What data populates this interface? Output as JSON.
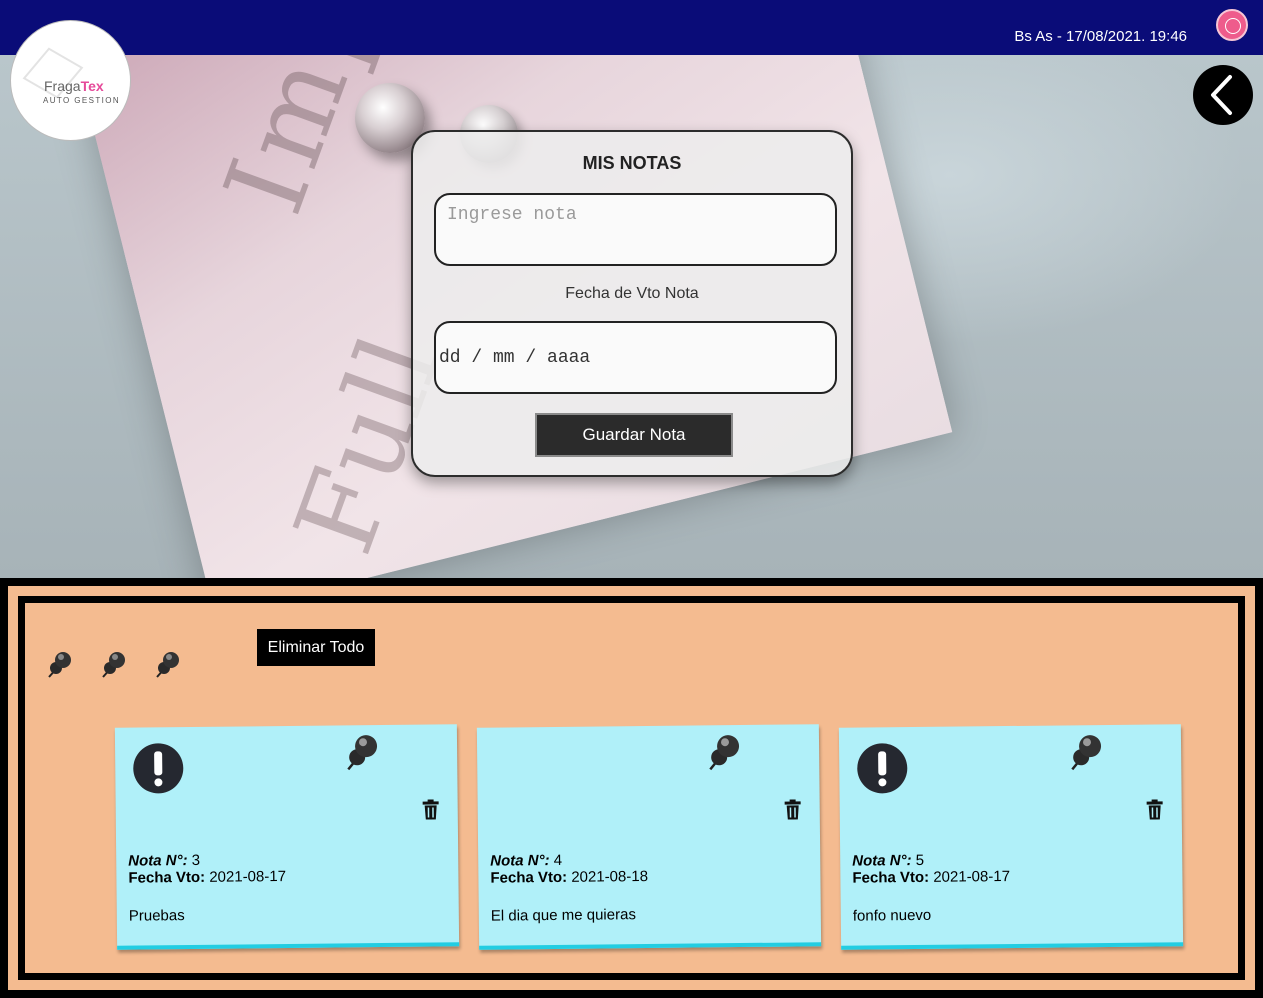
{
  "header": {
    "datetime": "Bs As - 17/08/2021. 19:46"
  },
  "logo": {
    "brand_a": "Fraga",
    "brand_b": "Tex",
    "subtitle": "AUTO GESTION"
  },
  "form": {
    "title": "MIS NOTAS",
    "note_placeholder": "Ingrese nota",
    "date_label": "Fecha de Vto Nota",
    "date_placeholder": "dd / mm / aaaa",
    "save_label": "Guardar Nota"
  },
  "board": {
    "delete_all_label": "Eliminar Todo",
    "number_label": "Nota N°:",
    "due_label": "Fecha Vto:",
    "notes": [
      {
        "number": "3",
        "due": "2021-08-17",
        "text": "Pruebas",
        "alert": true
      },
      {
        "number": "4",
        "due": "2021-08-18",
        "text": "El dia que me quieras",
        "alert": false
      },
      {
        "number": "5",
        "due": "2021-08-17",
        "text": "fonfo nuevo",
        "alert": true
      }
    ]
  },
  "colors": {
    "topbar": "#0a0c78",
    "board": "#f4bb90",
    "note": "#b0f0f9",
    "note_border": "#22cde2",
    "power_button": "#ee5c8c"
  },
  "icons": [
    "power-icon",
    "back-chevron-icon",
    "pushpin-icon",
    "alert-icon",
    "trash-icon"
  ]
}
